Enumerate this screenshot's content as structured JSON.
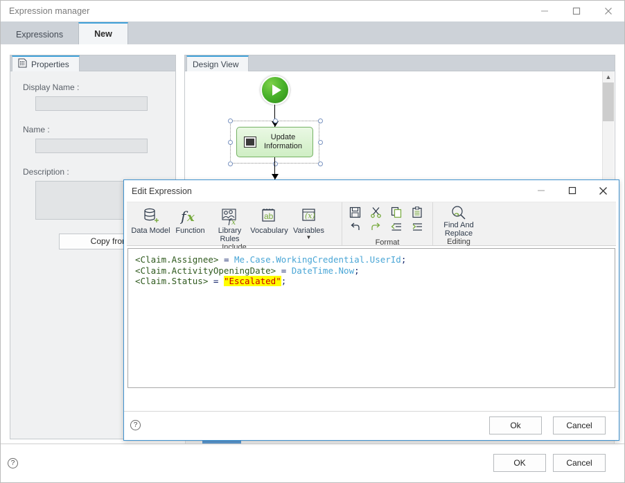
{
  "main_window": {
    "title": "Expression manager",
    "window_controls": {
      "minimize": "minimize-icon",
      "maximize": "maximize-icon",
      "close": "close-icon"
    },
    "tabs": [
      {
        "label": "Expressions",
        "active": false
      },
      {
        "label": "New",
        "active": true
      }
    ],
    "footer": {
      "help": "?",
      "ok_label": "OK",
      "cancel_label": "Cancel"
    }
  },
  "properties_panel": {
    "tab_label": "Properties",
    "tab_icon": "properties-icon",
    "fields": [
      {
        "label": "Display Name :",
        "value": "",
        "placeholder": ""
      },
      {
        "label": "Name :",
        "value": "",
        "placeholder": ""
      },
      {
        "label": "Description :",
        "value": "",
        "placeholder": ""
      }
    ],
    "copy_from_label": "Copy from ..."
  },
  "design_panel": {
    "tab_label": "Design View",
    "nodes": [
      {
        "type": "start",
        "label": "",
        "icon": "play-start-icon"
      },
      {
        "type": "activity",
        "label": "Update Information",
        "icon": "activity-icon",
        "selected": true
      }
    ],
    "scrollbar": {
      "up": "chevron-up-icon",
      "down": "chevron-down-icon"
    }
  },
  "edit_expression_dialog": {
    "title": "Edit Expression",
    "window_controls": {
      "minimize": "minimize-icon",
      "maximize": "maximize-icon",
      "close": "close-icon"
    },
    "ribbon": {
      "groups": [
        {
          "title": "Include",
          "buttons": [
            {
              "label": "Data Model",
              "icon": "data-model-icon"
            },
            {
              "label": "Function",
              "icon": "function-fx-icon"
            },
            {
              "label": "Library Rules",
              "icon": "library-rules-icon"
            },
            {
              "label": "Vocabulary",
              "icon": "vocabulary-ab-icon"
            },
            {
              "label": "Variables",
              "icon": "variables-x-icon",
              "has_dropdown": true
            }
          ]
        },
        {
          "title": "Format",
          "small_buttons": [
            {
              "icon": "save-icon"
            },
            {
              "icon": "cut-scissors-icon"
            },
            {
              "icon": "copy-icon"
            },
            {
              "icon": "paste-icon"
            },
            {
              "icon": "undo-icon"
            },
            {
              "icon": "redo-icon"
            },
            {
              "icon": "decrease-indent-icon"
            },
            {
              "icon": "increase-indent-icon"
            }
          ]
        },
        {
          "title": "Editing",
          "buttons": [
            {
              "label": "Find And Replace",
              "icon": "find-replace-magnifier-icon"
            }
          ]
        }
      ]
    },
    "code": {
      "lines": [
        [
          {
            "t": "<Claim.Assignee>",
            "k": "tag"
          },
          {
            "t": " = ",
            "k": "op"
          },
          {
            "t": "Me.Case.WorkingCredential.UserId",
            "k": "ref"
          },
          {
            "t": ";",
            "k": "semi"
          }
        ],
        [
          {
            "t": "<Claim.ActivityOpeningDate>",
            "k": "tag"
          },
          {
            "t": " = ",
            "k": "op"
          },
          {
            "t": "DateTime.Now",
            "k": "ref"
          },
          {
            "t": ";",
            "k": "semi"
          }
        ],
        [
          {
            "t": "<Claim.Status>",
            "k": "tag"
          },
          {
            "t": " = ",
            "k": "op"
          },
          {
            "t": "\"Escalated\"",
            "k": "str"
          },
          {
            "t": ";",
            "k": "semi"
          }
        ]
      ]
    },
    "footer": {
      "help": "?",
      "ok_label": "Ok",
      "cancel_label": "Cancel"
    }
  },
  "colors": {
    "accent_blue": "#3f92cf",
    "tab_strip": "#cdd2d8",
    "ribbon_bg": "#f1f1f1",
    "node_green": "#74b163",
    "start_green": "#49b22a",
    "string_red": "#cc0000",
    "highlight_yellow": "#ffff00",
    "tag_green": "#2f5a1e",
    "ref_blue": "#4aa6d6",
    "op_navy": "#15266b"
  }
}
